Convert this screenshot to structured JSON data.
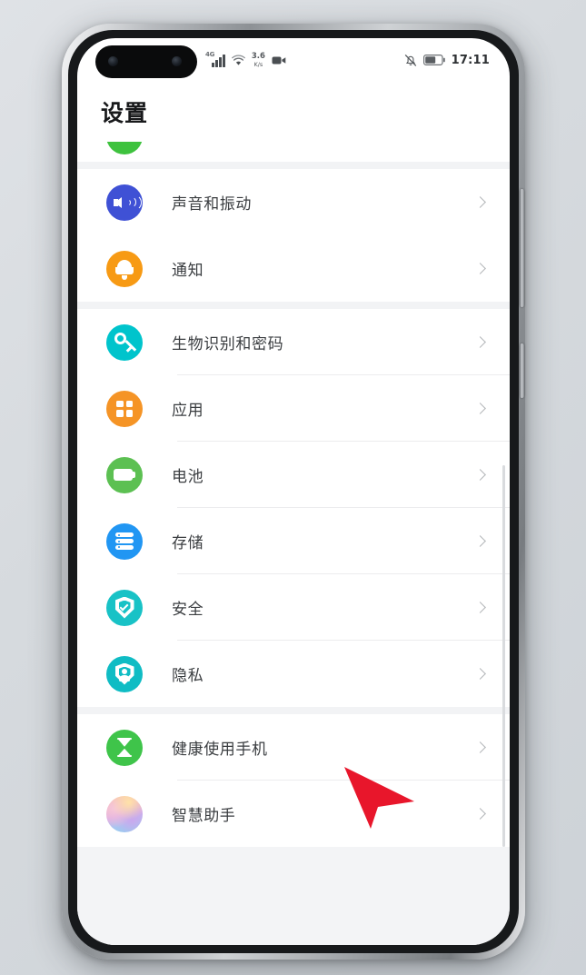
{
  "device": {
    "frame": "huawei-punch-hole-phone",
    "accent_bezel": "#17191b"
  },
  "status_bar": {
    "network_gen": "4G",
    "signal_icon": "signal-bars-icon",
    "wifi_icon": "wifi-icon",
    "net_speed_value": "3.6",
    "net_speed_unit": "K/s",
    "screen_record_icon": "video-record-icon",
    "mute_icon": "bell-mute-icon",
    "battery_icon": "battery-icon",
    "time": "17:11"
  },
  "header": {
    "title": "设置"
  },
  "sections": [
    {
      "name": "clipped-top",
      "clipped_icon_color": "#3ec23e",
      "items": []
    },
    {
      "name": "sound-notification",
      "items": [
        {
          "label": "声音和振动",
          "icon": "speaker-volume-icon",
          "icon_color": "#3f51d5",
          "chevron": "chevron-right-icon",
          "divider": false
        },
        {
          "label": "通知",
          "icon": "bell-icon",
          "icon_color": "#f79a14",
          "chevron": "chevron-right-icon",
          "divider": false
        }
      ]
    },
    {
      "name": "system-core",
      "items": [
        {
          "label": "生物识别和密码",
          "icon": "key-icon",
          "icon_color": "#00c4cc",
          "chevron": "chevron-right-icon",
          "divider": true
        },
        {
          "label": "应用",
          "icon": "app-grid-icon",
          "icon_color": "#f59426",
          "chevron": "chevron-right-icon",
          "divider": true
        },
        {
          "label": "电池",
          "icon": "battery-icon",
          "icon_color": "#5cc052",
          "chevron": "chevron-right-icon",
          "divider": true
        },
        {
          "label": "存储",
          "icon": "storage-stack-icon",
          "icon_color": "#2196f3",
          "chevron": "chevron-right-icon",
          "divider": true
        },
        {
          "label": "安全",
          "icon": "shield-check-icon",
          "icon_color": "#18c2c6",
          "chevron": "chevron-right-icon",
          "divider": true
        },
        {
          "label": "隐私",
          "icon": "shield-person-icon",
          "icon_color": "#0fbcc4",
          "chevron": "chevron-right-icon",
          "divider": false
        }
      ]
    },
    {
      "name": "wellbeing-assistant",
      "items": [
        {
          "label": "健康使用手机",
          "icon": "hourglass-icon",
          "icon_color": "#3fc44a",
          "chevron": "chevron-right-icon",
          "divider": true
        },
        {
          "label": "智慧助手",
          "icon": "gradient-sphere-icon",
          "icon_color": "#dcaee6",
          "chevron": "chevron-right-icon",
          "divider": false
        }
      ]
    }
  ],
  "cursor": {
    "type": "arrow-pointer",
    "color": "#e8162b"
  },
  "scrollbar": {
    "visible": true,
    "color": "#d9dbde"
  }
}
